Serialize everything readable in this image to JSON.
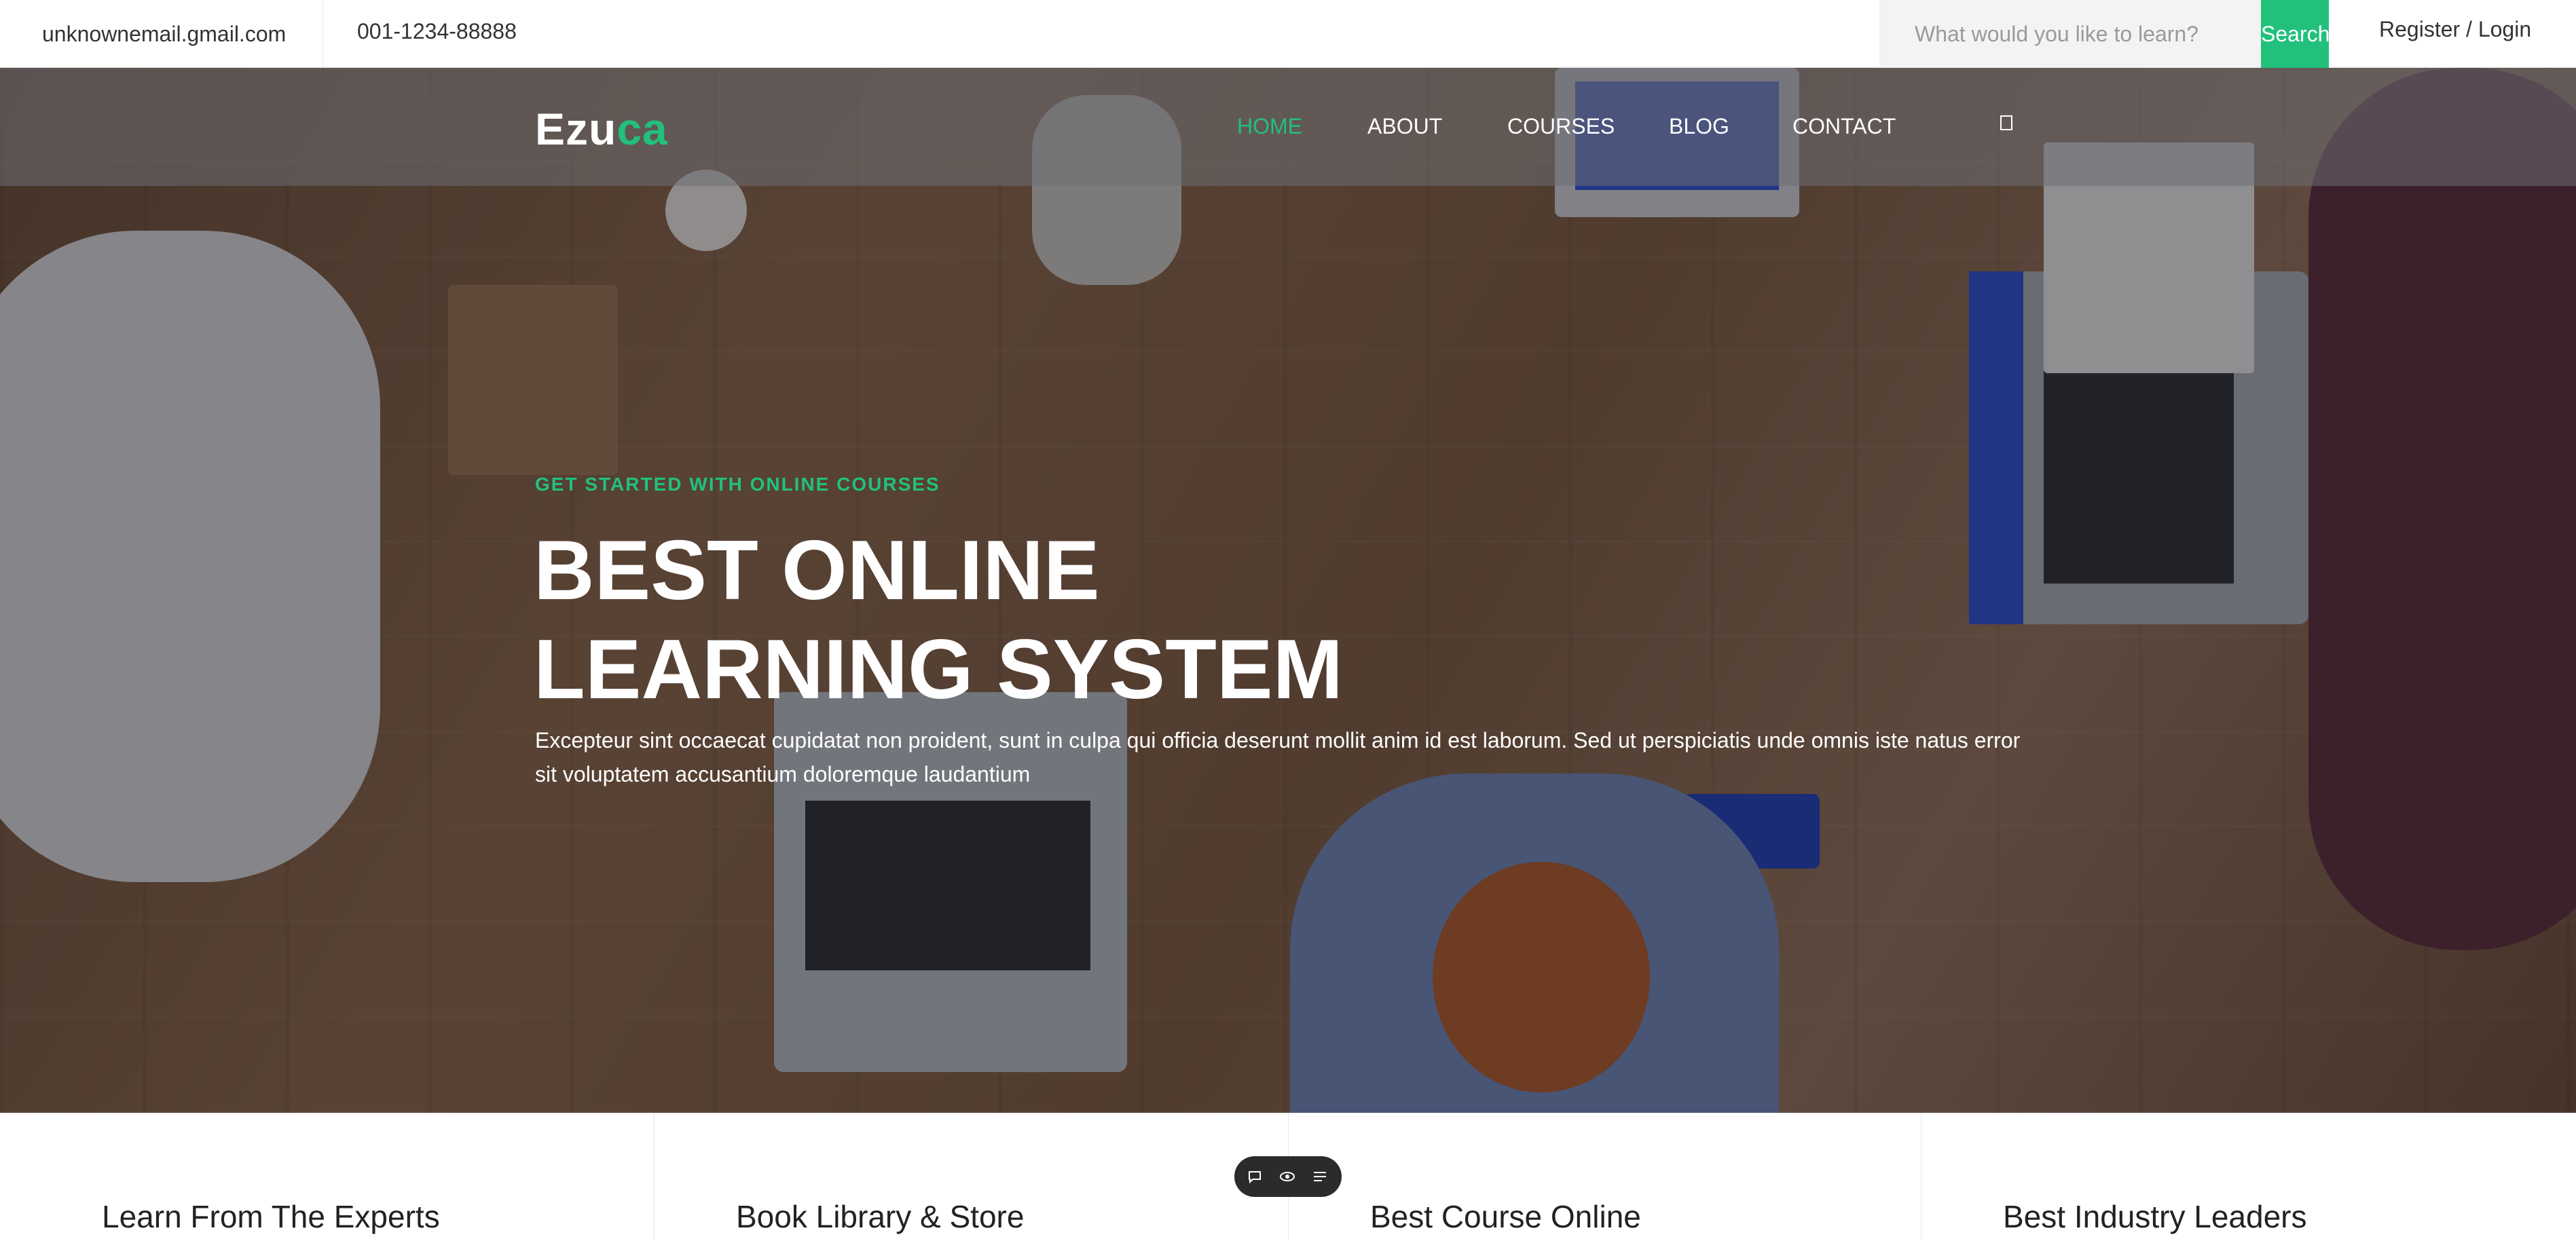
{
  "topbar": {
    "email": "unknownemail.gmail.com",
    "phone": "001-1234-88888",
    "search_placeholder": "What would you like to learn?",
    "search_button": "Search",
    "auth": "Register / Login"
  },
  "brand": {
    "logo_main": "Ezu",
    "logo_accent": "ca",
    "accent_color": "#21c17c"
  },
  "nav": {
    "items": [
      {
        "label": "HOME",
        "active": true
      },
      {
        "label": "ABOUT"
      },
      {
        "label": "COURSES"
      },
      {
        "label": "BLOG"
      },
      {
        "label": "CONTACT"
      }
    ],
    "extra_icon": "square-icon"
  },
  "hero": {
    "eyebrow": "GET STARTED WITH ONLINE COURSES",
    "title_line1": "BEST ONLINE",
    "title_line2": "LEARNING SYSTEM",
    "description": "Excepteur sint occaecat cupidatat non proident, sunt in culpa qui officia deserunt mollit anim id est laborum. Sed ut perspiciatis unde omnis iste natus error sit voluptatem accusantium doloremque laudantium"
  },
  "features": [
    {
      "title": "Learn From The Experts"
    },
    {
      "title": "Book Library & Store"
    },
    {
      "title": "Best Course Online"
    },
    {
      "title": "Best Industry Leaders"
    }
  ],
  "widget": {
    "icons": [
      "chat-icon",
      "eye-icon",
      "list-icon"
    ]
  }
}
